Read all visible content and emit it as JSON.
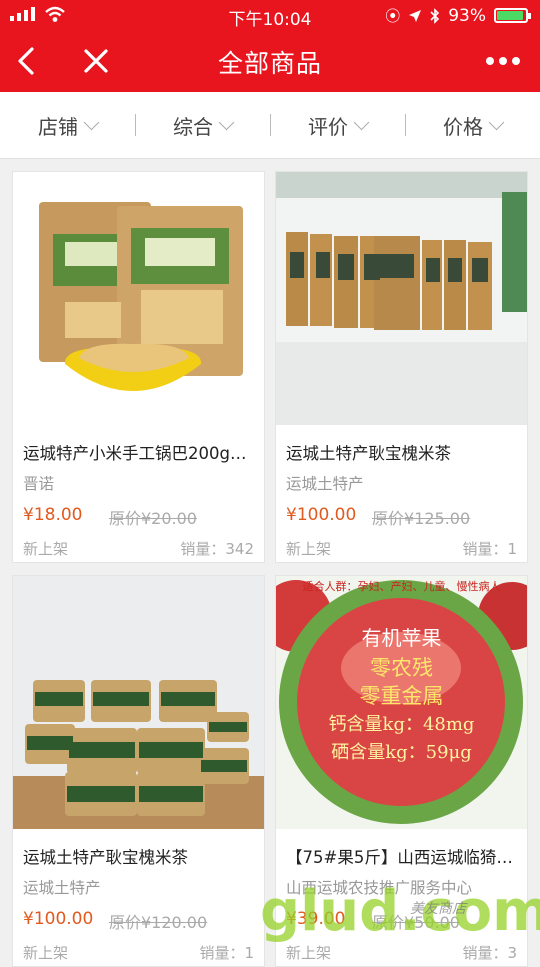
{
  "status_bar": {
    "time": "下午10:04",
    "battery": "93%",
    "battery_level": 0.93
  },
  "nav": {
    "title": "全部商品"
  },
  "filters": [
    "店铺",
    "综合",
    "评价",
    "价格"
  ],
  "products": [
    {
      "name": "运城特产小米手工锅巴200g…",
      "shop": "晋诺",
      "price": "¥18.00",
      "original_price": "原价¥20.00",
      "tag": "新上架",
      "sales": "销量：342"
    },
    {
      "name": "运城土特产耿宝槐米茶",
      "shop": "运城土特产",
      "price": "¥100.00",
      "original_price": "原价¥125.00",
      "tag": "新上架",
      "sales": "销量：1"
    },
    {
      "name": "运城土特产耿宝槐米茶",
      "shop": "运城土特产",
      "price": "¥100.00",
      "original_price": "原价¥120.00",
      "tag": "新上架",
      "sales": "销量：1"
    },
    {
      "name": "【75#果5斤】山西运城临猗…",
      "shop": "山西运城农技推广服务中心",
      "price": "¥39.00",
      "original_price": "原价¥50.00",
      "tag": "新上架",
      "sales": "销量：3"
    }
  ],
  "apple_label": {
    "title": "有机苹果",
    "line1": "零农残",
    "line2": "零重金属",
    "line3": "钙含量kg：48mg",
    "line4": "硒含量kg：59μg",
    "ring_text": "适合人群：孕妇、产妇、儿童、慢性病人"
  },
  "watermark": {
    "text": "glud.com",
    "sub": "美友商店"
  }
}
